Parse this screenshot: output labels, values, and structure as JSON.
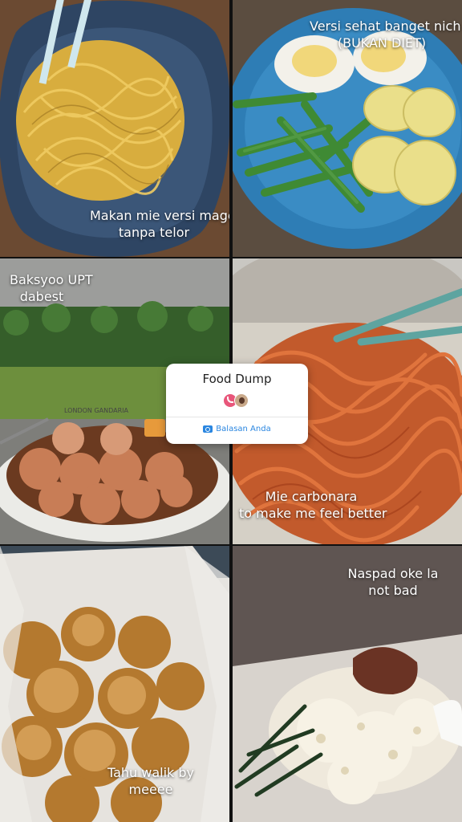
{
  "tiles": [
    {
      "name": "mie-tile",
      "caption": [
        "Makan mie versi mager",
        "tanpa telor"
      ]
    },
    {
      "name": "sayur-tile",
      "caption": [
        "Versi sehat banget nich",
        "(BUKAN DIET)"
      ]
    },
    {
      "name": "bakso-tile",
      "caption": [
        "Baksyoo UPT",
        "dabest"
      ]
    },
    {
      "name": "carbonara-tile",
      "caption": [
        "Mie carbonara",
        "to make me feel better"
      ]
    },
    {
      "name": "tahu-tile",
      "caption": [
        "Tahu walik by",
        "meeee"
      ]
    },
    {
      "name": "naspad-tile",
      "caption": [
        "Naspad oke la",
        "not bad"
      ]
    }
  ],
  "bowl_text": "LONDON GANDARIA",
  "card": {
    "title": "Food Dump",
    "reply_label": "Balasan Anda",
    "camera_icon": "camera-icon",
    "avatar_icons": [
      "reply-arrow-icon",
      "profile-avatar"
    ]
  },
  "colors": {
    "card_bg": "#ffffff",
    "reply_blue": "#2a86e0"
  }
}
